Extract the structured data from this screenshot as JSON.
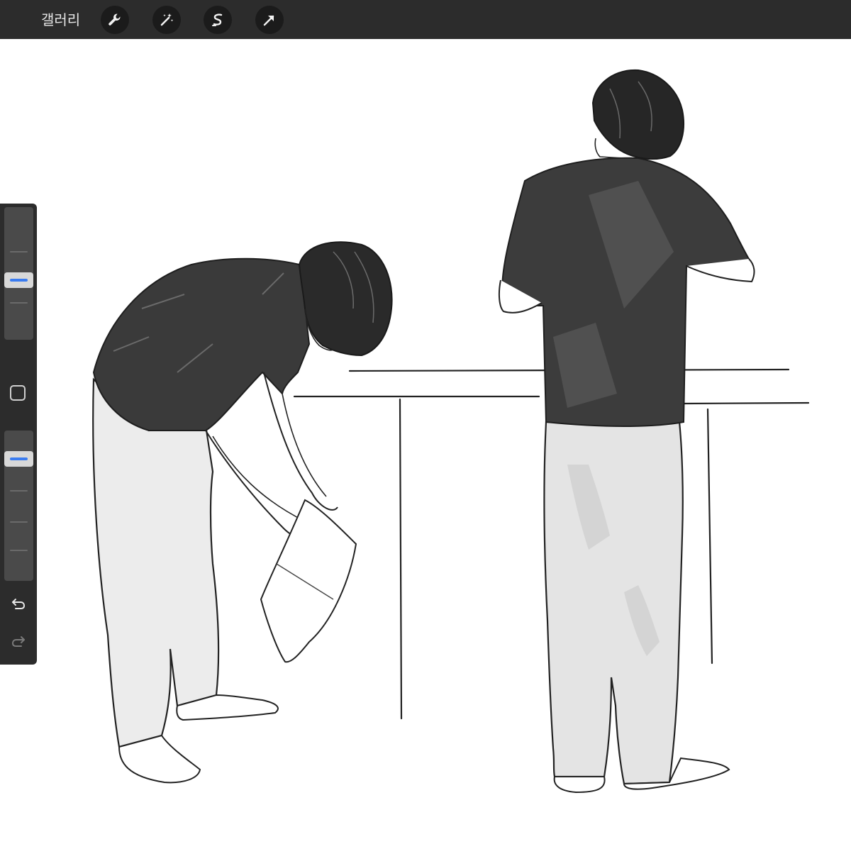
{
  "topbar": {
    "gallery_label": "갤러리",
    "tools": [
      {
        "name": "wrench-icon",
        "action": "actions"
      },
      {
        "name": "magic-wand-icon",
        "action": "adjustments"
      },
      {
        "name": "selection-s-icon",
        "action": "selection"
      },
      {
        "name": "transform-arrow-icon",
        "action": "transform"
      }
    ]
  },
  "sidebar": {
    "brush_size_level": 0.56,
    "opacity_level": 0.15
  },
  "colors": {
    "toolbar_bg": "#2c2c2c",
    "accent": "#3b7cf0",
    "canvas_bg": "#ffffff"
  }
}
